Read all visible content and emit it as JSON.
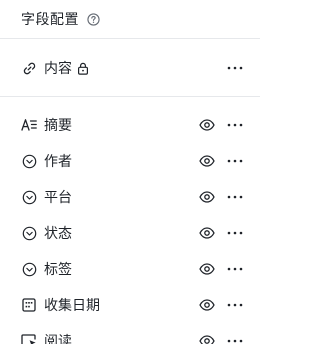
{
  "header": {
    "title": "字段配置",
    "help_icon": "help-circle-icon"
  },
  "primary_field": {
    "label": "内容",
    "icon": "link-icon",
    "lock_icon": "lock-icon"
  },
  "fields": [
    {
      "label": "摘要",
      "icon": "text-format-icon",
      "visible": true
    },
    {
      "label": "作者",
      "icon": "dropdown-circle-icon",
      "visible": true
    },
    {
      "label": "平台",
      "icon": "dropdown-circle-icon",
      "visible": true
    },
    {
      "label": "状态",
      "icon": "dropdown-circle-icon",
      "visible": true
    },
    {
      "label": "标签",
      "icon": "dropdown-circle-icon",
      "visible": true
    },
    {
      "label": "收集日期",
      "icon": "calendar-icon",
      "visible": true
    },
    {
      "label": "阅读",
      "icon": "read-cursor-icon",
      "visible": true
    }
  ],
  "colors": {
    "text": "#1f2329",
    "icon": "#1f2329",
    "divider": "#e6e8eb"
  }
}
